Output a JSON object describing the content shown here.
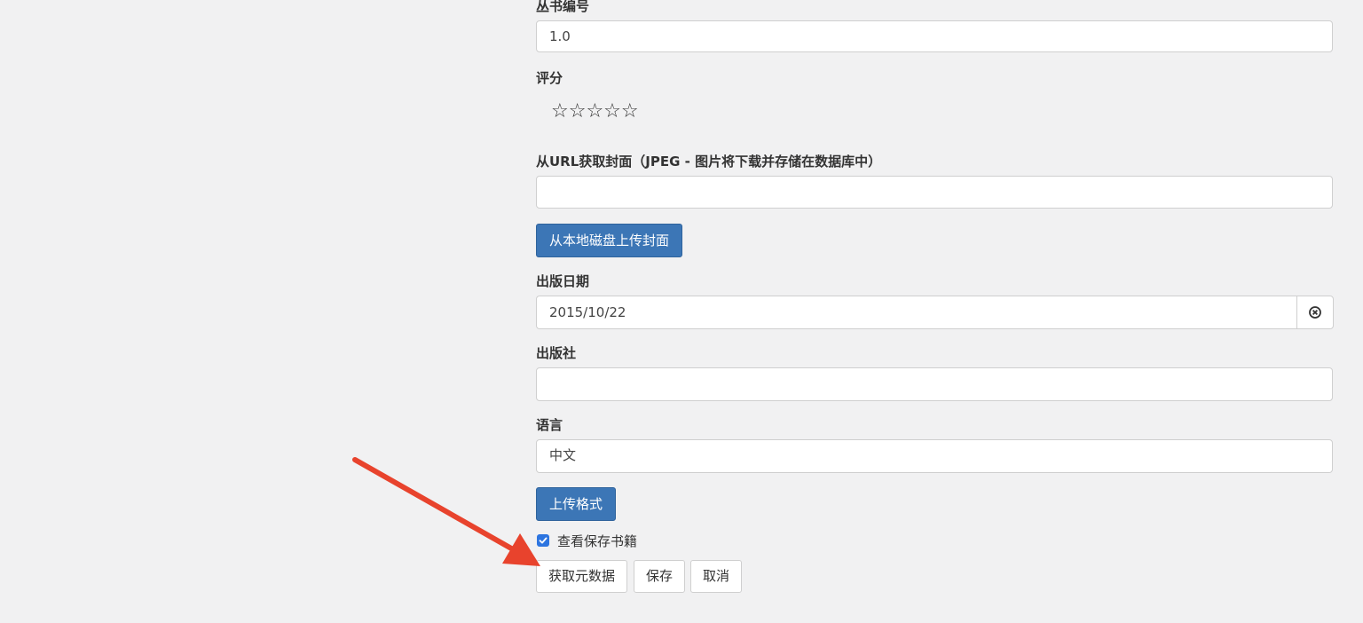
{
  "fields": {
    "series_index": {
      "label": "丛书编号",
      "value": "1.0"
    },
    "rating": {
      "label": "评分",
      "stars_display": "☆☆☆☆☆",
      "value": 0,
      "max": 5
    },
    "cover_url": {
      "label": "从URL获取封面（JPEG - 图片将下载并存储在数据库中）",
      "value": ""
    },
    "upload_cover_button": "从本地磁盘上传封面",
    "pubdate": {
      "label": "出版日期",
      "value": "2015/10/22",
      "clear_icon": "circle-x-icon"
    },
    "publisher": {
      "label": "出版社",
      "value": ""
    },
    "language": {
      "label": "语言",
      "value": "中文"
    },
    "upload_format_button": "上传格式",
    "view_after_save": {
      "label": "查看保存书籍",
      "checked": true
    }
  },
  "actions": {
    "fetch_metadata": "获取元数据",
    "save": "保存",
    "cancel": "取消"
  },
  "colors": {
    "primary_button": "#3c76b6",
    "checkbox": "#2d75e0",
    "annotation_arrow": "#e8432d",
    "background": "#f1f1f2"
  }
}
